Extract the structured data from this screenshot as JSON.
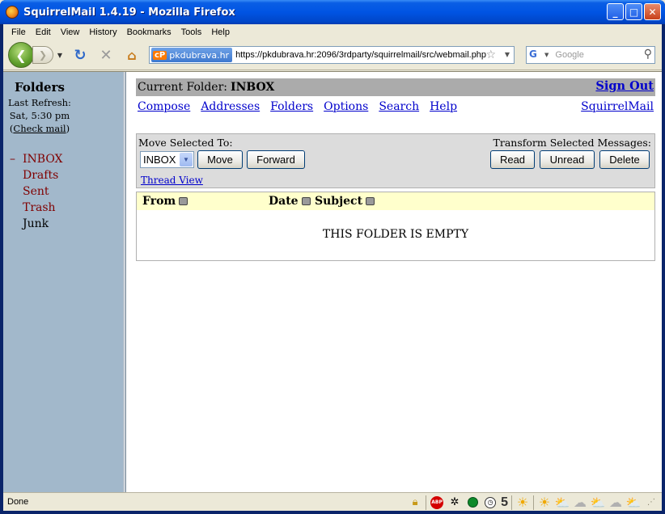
{
  "window": {
    "title": "SquirrelMail 1.4.19 - Mozilla Firefox"
  },
  "menubar": {
    "items": [
      "File",
      "Edit",
      "View",
      "History",
      "Bookmarks",
      "Tools",
      "Help"
    ]
  },
  "navbar": {
    "site_identity": "pkdubrava.hr",
    "site_logo": "cP",
    "url": "https://pkdubrava.hr:2096/3rdparty/squirrelmail/src/webmail.php",
    "search_placeholder": "Google"
  },
  "left": {
    "title": "Folders",
    "last_refresh_label": "Last Refresh:",
    "last_refresh_time": "Sat, 5:30 pm",
    "check_mail_open": "(",
    "check_mail": "Check mail",
    "check_mail_close": ")",
    "current_marker": "–",
    "folders": [
      {
        "name": "INBOX"
      },
      {
        "name": "Drafts"
      },
      {
        "name": "Sent"
      },
      {
        "name": "Trash"
      },
      {
        "name": "Junk"
      }
    ]
  },
  "main": {
    "current_folder_label": "Current Folder:",
    "current_folder": "INBOX",
    "sign_out": "Sign Out",
    "nav_links": [
      "Compose",
      "Addresses",
      "Folders",
      "Options",
      "Search",
      "Help"
    ],
    "brand_link": "SquirrelMail",
    "move_selected_label": "Move Selected To:",
    "transform_label": "Transform Selected Messages:",
    "move_select_value": "INBOX",
    "buttons": {
      "move": "Move",
      "forward": "Forward",
      "read": "Read",
      "unread": "Unread",
      "delete": "Delete"
    },
    "thread_view": "Thread View",
    "columns": {
      "from": "From",
      "date": "Date",
      "subject": "Subject"
    },
    "empty_message": "THIS FOLDER IS EMPTY"
  },
  "statusbar": {
    "text": "Done",
    "counter": "5"
  }
}
